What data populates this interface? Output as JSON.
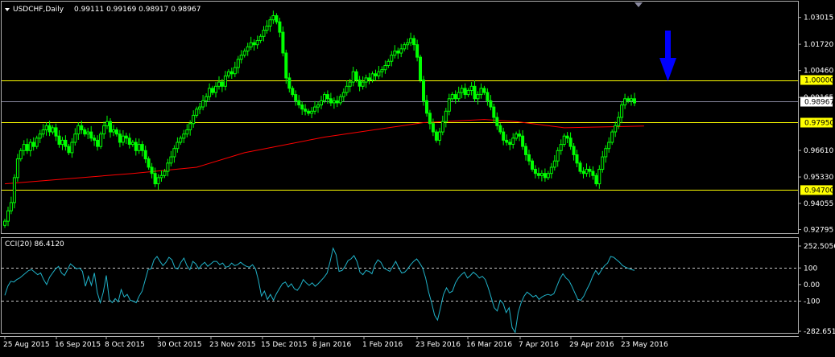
{
  "header": {
    "symbol_label": "USDCHF,Daily",
    "ohlc": "0.99111 0.99169 0.98917 0.98967"
  },
  "indicator": {
    "label": "CCI(20) 86.4120"
  },
  "colors": {
    "background": "#000000",
    "candle": "#00ff00",
    "moving_average": "#ff0000",
    "hline": "#ffff00",
    "price_line": "#8a8aa0",
    "cci_line": "#20b2c8",
    "arrow": "#0000ff",
    "axis_text": "#ffffff",
    "grid": "#b0b0b0"
  },
  "chart_data": [
    {
      "type": "candlestick",
      "title": "USDCHF,Daily",
      "y_ticks": [
        "1.03015",
        "1.01720",
        "1.00460",
        "0.99165",
        "0.96610",
        "0.95330",
        "0.94055",
        "0.92795"
      ],
      "ylim": [
        0.927,
        1.037
      ],
      "horizontal_lines": [
        {
          "value": 1.0,
          "label": "1.00000",
          "style": "yellow"
        },
        {
          "value": 0.9795,
          "label": "0.97950",
          "style": "yellow"
        },
        {
          "value": 0.947,
          "label": "0.94700",
          "style": "yellow"
        }
      ],
      "current_price": {
        "value": 0.98967,
        "label": "0.98967"
      },
      "x_ticks": [
        "25 Aug 2015",
        "16 Sep 2015",
        "8 Oct 2015",
        "30 Oct 2015",
        "23 Nov 2015",
        "15 Dec 2015",
        "8 Jan 2016",
        "1 Feb 2016",
        "23 Feb 2016",
        "16 Mar 2016",
        "7 Apr 2016",
        "29 Apr 2016",
        "23 May 2016"
      ],
      "close": [
        0.932,
        0.937,
        0.941,
        0.953,
        0.962,
        0.966,
        0.969,
        0.966,
        0.97,
        0.968,
        0.972,
        0.974,
        0.976,
        0.978,
        0.975,
        0.977,
        0.973,
        0.969,
        0.971,
        0.968,
        0.965,
        0.97,
        0.974,
        0.978,
        0.976,
        0.974,
        0.975,
        0.972,
        0.971,
        0.968,
        0.974,
        0.978,
        0.98,
        0.975,
        0.976,
        0.974,
        0.97,
        0.973,
        0.972,
        0.969,
        0.97,
        0.966,
        0.969,
        0.966,
        0.962,
        0.958,
        0.955,
        0.95,
        0.953,
        0.954,
        0.956,
        0.96,
        0.963,
        0.967,
        0.97,
        0.972,
        0.974,
        0.976,
        0.979,
        0.983,
        0.986,
        0.987,
        0.99,
        0.992,
        0.996,
        0.994,
        0.997,
        0.999,
        0.997,
        1.002,
        1.004,
        1.003,
        1.006,
        1.01,
        1.012,
        1.014,
        1.016,
        1.018,
        1.017,
        1.019,
        1.021,
        1.024,
        1.026,
        1.029,
        1.031,
        1.028,
        1.023,
        1.013,
        1.001,
        0.996,
        0.993,
        0.99,
        0.988,
        0.986,
        0.985,
        0.984,
        0.985,
        0.987,
        0.988,
        0.99,
        0.993,
        0.991,
        0.989,
        0.99,
        0.989,
        0.992,
        0.994,
        0.997,
        0.999,
        1.004,
        1.0,
        0.997,
        0.999,
        1.001,
        1.0,
        1.003,
        1.002,
        1.004,
        1.005,
        1.007,
        1.009,
        1.012,
        1.014,
        1.013,
        1.015,
        1.017,
        1.018,
        1.02,
        1.017,
        1.011,
        1.0,
        0.99,
        0.984,
        0.979,
        0.975,
        0.971,
        0.975,
        0.98,
        0.985,
        0.991,
        0.993,
        0.991,
        0.994,
        0.996,
        0.993,
        0.995,
        0.997,
        0.991,
        0.993,
        0.996,
        0.994,
        0.99,
        0.987,
        0.982,
        0.978,
        0.975,
        0.971,
        0.97,
        0.969,
        0.972,
        0.974,
        0.973,
        0.968,
        0.964,
        0.961,
        0.957,
        0.955,
        0.954,
        0.955,
        0.953,
        0.955,
        0.958,
        0.961,
        0.966,
        0.969,
        0.973,
        0.972,
        0.968,
        0.964,
        0.96,
        0.956,
        0.955,
        0.957,
        0.956,
        0.954,
        0.95,
        0.957,
        0.963,
        0.967,
        0.97,
        0.975,
        0.978,
        0.982,
        0.988,
        0.991,
        0.99,
        0.991,
        0.989
      ],
      "moving_average": {
        "name": "",
        "points": [
          [
            0,
            0.95
          ],
          [
            40,
            0.955
          ],
          [
            60,
            0.958
          ],
          [
            75,
            0.965
          ],
          [
            100,
            0.9725
          ],
          [
            120,
            0.977
          ],
          [
            131,
            0.9795
          ],
          [
            150,
            0.981
          ],
          [
            160,
            0.98
          ],
          [
            175,
            0.977
          ],
          [
            190,
            0.9775
          ],
          [
            200,
            0.9778
          ]
        ]
      }
    },
    {
      "type": "line",
      "title": "CCI(20) 86.4120",
      "y_ticks": [
        "252.5056",
        "100",
        "0.00",
        "-100",
        "-282.6519"
      ],
      "ylim": [
        -282.6519,
        252.5056
      ],
      "dashed_levels": [
        100,
        -100
      ],
      "values": [
        -65,
        -10,
        20,
        15,
        30,
        40,
        55,
        70,
        85,
        90,
        75,
        60,
        70,
        30,
        0,
        45,
        70,
        95,
        110,
        70,
        55,
        90,
        125,
        110,
        95,
        100,
        80,
        -10,
        50,
        -5,
        70,
        -50,
        -110,
        -45,
        55,
        -90,
        -110,
        -85,
        -105,
        -30,
        -75,
        -60,
        -95,
        -100,
        -110,
        -70,
        -40,
        25,
        90,
        95,
        150,
        170,
        140,
        115,
        135,
        165,
        150,
        100,
        95,
        135,
        160,
        115,
        90,
        140,
        125,
        95,
        120,
        135,
        110,
        125,
        140,
        140,
        120,
        130,
        105,
        110,
        130,
        115,
        120,
        135,
        120,
        110,
        105,
        120,
        95,
        25,
        -70,
        -40,
        -90,
        -60,
        -95,
        -55,
        -25,
        5,
        15,
        -15,
        5,
        -25,
        -35,
        -10,
        30,
        10,
        -5,
        10,
        -10,
        5,
        25,
        45,
        70,
        140,
        220,
        180,
        80,
        85,
        110,
        145,
        155,
        175,
        140,
        75,
        60,
        85,
        80,
        65,
        120,
        150,
        135,
        100,
        90,
        80,
        110,
        140,
        100,
        70,
        75,
        95,
        120,
        140,
        155,
        130,
        100,
        40,
        -45,
        -110,
        -185,
        -215,
        -140,
        -60,
        -20,
        -50,
        -40,
        10,
        40,
        60,
        75,
        40,
        55,
        75,
        60,
        40,
        50,
        30,
        -20,
        -80,
        -140,
        -160,
        -95,
        -115,
        -170,
        -140,
        -260,
        -290,
        -170,
        -110,
        -70,
        -45,
        -60,
        -75,
        -65,
        -90,
        -75,
        -65,
        -60,
        -65,
        -55,
        -10,
        35,
        65,
        40,
        25,
        -10,
        -50,
        -90,
        -95,
        -70,
        -30,
        5,
        50,
        85,
        60,
        90,
        115,
        130,
        170,
        165,
        150,
        135,
        115,
        105,
        98,
        90,
        86
      ]
    }
  ],
  "annotations": {
    "arrow": "down-arrow"
  }
}
